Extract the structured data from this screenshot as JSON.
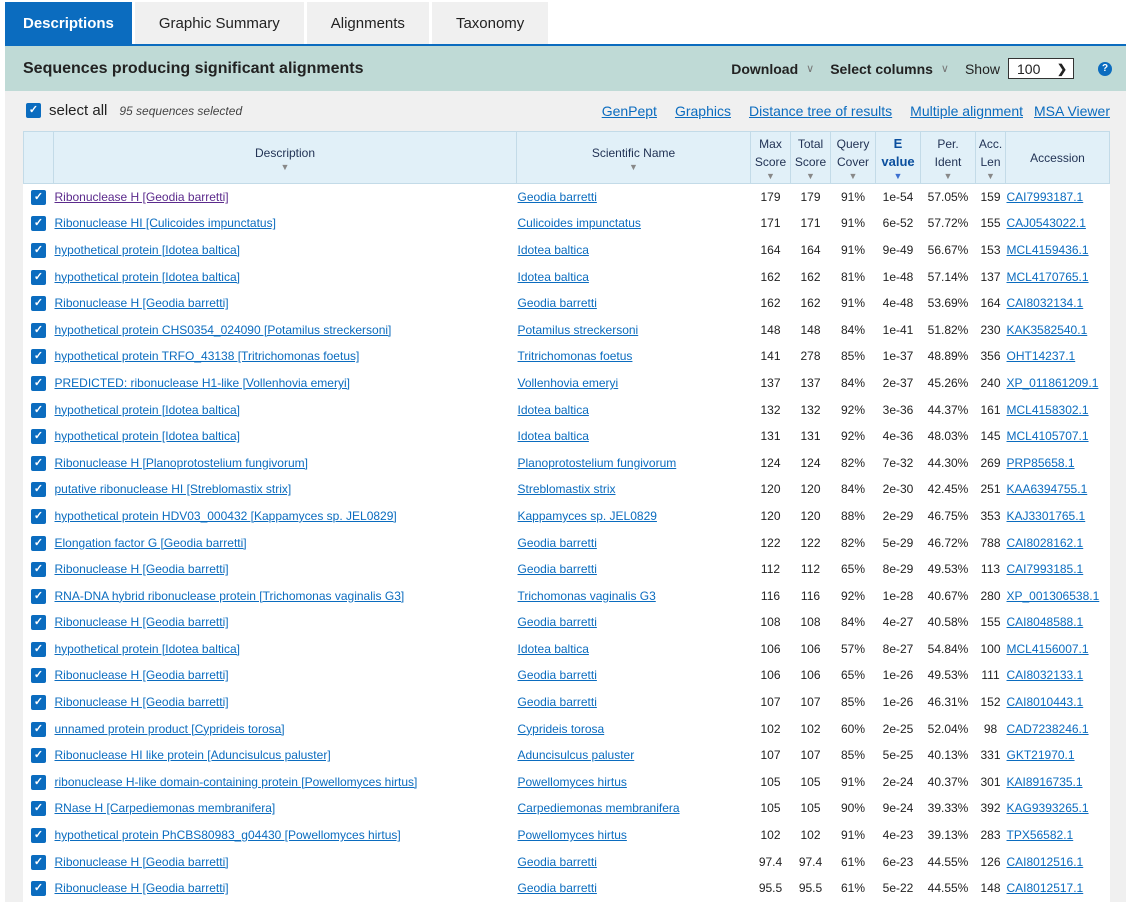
{
  "tabs": [
    "Descriptions",
    "Graphic Summary",
    "Alignments",
    "Taxonomy"
  ],
  "active_tab": 0,
  "header": {
    "title": "Sequences producing significant alignments",
    "download": "Download",
    "select_columns": "Select columns",
    "show_label": "Show",
    "show_value": "100"
  },
  "toolbar": {
    "select_all": "select all",
    "selected_count": "95 sequences selected",
    "links": [
      "GenPept",
      "Graphics",
      "Distance tree of results",
      "Multiple alignment",
      "MSA Viewer"
    ]
  },
  "columns": {
    "description": "Description",
    "scientific_name": "Scientific Name",
    "max_score": [
      "Max",
      "Score"
    ],
    "total_score": [
      "Total",
      "Score"
    ],
    "query_cover": [
      "Query",
      "Cover"
    ],
    "e_value": [
      "E",
      "value"
    ],
    "per_ident": [
      "Per.",
      "Ident"
    ],
    "acc_len": [
      "Acc.",
      "Len"
    ],
    "accession": "Accession"
  },
  "sorted_column": "e_value",
  "colors": {
    "accent": "#0b6cbf",
    "header_bar": "#bfdad6",
    "visited_link": "#5b2a8c"
  },
  "rows": [
    {
      "desc": "Ribonuclease H [Geodia barretti]",
      "sci": "Geodia barretti",
      "max": "179",
      "total": "179",
      "cover": "91%",
      "e": "1e-54",
      "ident": "57.05%",
      "len": "159",
      "acc": "CAI7993187.1",
      "visited": true
    },
    {
      "desc": "Ribonuclease HI [Culicoides impunctatus]",
      "sci": "Culicoides impunctatus",
      "max": "171",
      "total": "171",
      "cover": "91%",
      "e": "6e-52",
      "ident": "57.72%",
      "len": "155",
      "acc": "CAJ0543022.1"
    },
    {
      "desc": "hypothetical protein [Idotea baltica]",
      "sci": "Idotea baltica",
      "max": "164",
      "total": "164",
      "cover": "91%",
      "e": "9e-49",
      "ident": "56.67%",
      "len": "153",
      "acc": "MCL4159436.1"
    },
    {
      "desc": "hypothetical protein [Idotea baltica]",
      "sci": "Idotea baltica",
      "max": "162",
      "total": "162",
      "cover": "81%",
      "e": "1e-48",
      "ident": "57.14%",
      "len": "137",
      "acc": "MCL4170765.1"
    },
    {
      "desc": "Ribonuclease H [Geodia barretti]",
      "sci": "Geodia barretti",
      "max": "162",
      "total": "162",
      "cover": "91%",
      "e": "4e-48",
      "ident": "53.69%",
      "len": "164",
      "acc": "CAI8032134.1"
    },
    {
      "desc": "hypothetical protein CHS0354_024090 [Potamilus streckersoni]",
      "sci": "Potamilus streckersoni",
      "max": "148",
      "total": "148",
      "cover": "84%",
      "e": "1e-41",
      "ident": "51.82%",
      "len": "230",
      "acc": "KAK3582540.1"
    },
    {
      "desc": "hypothetical protein TRFO_43138 [Tritrichomonas foetus]",
      "sci": "Tritrichomonas foetus",
      "max": "141",
      "total": "278",
      "cover": "85%",
      "e": "1e-37",
      "ident": "48.89%",
      "len": "356",
      "acc": "OHT14237.1"
    },
    {
      "desc": "PREDICTED: ribonuclease H1-like [Vollenhovia emeryi]",
      "sci": "Vollenhovia emeryi",
      "max": "137",
      "total": "137",
      "cover": "84%",
      "e": "2e-37",
      "ident": "45.26%",
      "len": "240",
      "acc": "XP_011861209.1"
    },
    {
      "desc": "hypothetical protein [Idotea baltica]",
      "sci": "Idotea baltica",
      "max": "132",
      "total": "132",
      "cover": "92%",
      "e": "3e-36",
      "ident": "44.37%",
      "len": "161",
      "acc": "MCL4158302.1"
    },
    {
      "desc": "hypothetical protein [Idotea baltica]",
      "sci": "Idotea baltica",
      "max": "131",
      "total": "131",
      "cover": "92%",
      "e": "4e-36",
      "ident": "48.03%",
      "len": "145",
      "acc": "MCL4105707.1"
    },
    {
      "desc": "Ribonuclease H [Planoprotostelium fungivorum]",
      "sci": "Planoprotostelium fungivorum",
      "max": "124",
      "total": "124",
      "cover": "82%",
      "e": "7e-32",
      "ident": "44.30%",
      "len": "269",
      "acc": "PRP85658.1"
    },
    {
      "desc": "putative ribonuclease HI [Streblomastix strix]",
      "sci": "Streblomastix strix",
      "max": "120",
      "total": "120",
      "cover": "84%",
      "e": "2e-30",
      "ident": "42.45%",
      "len": "251",
      "acc": "KAA6394755.1"
    },
    {
      "desc": "hypothetical protein HDV03_000432 [Kappamyces sp. JEL0829]",
      "sci": "Kappamyces sp. JEL0829",
      "max": "120",
      "total": "120",
      "cover": "88%",
      "e": "2e-29",
      "ident": "46.75%",
      "len": "353",
      "acc": "KAJ3301765.1"
    },
    {
      "desc": "Elongation factor G [Geodia barretti]",
      "sci": "Geodia barretti",
      "max": "122",
      "total": "122",
      "cover": "82%",
      "e": "5e-29",
      "ident": "46.72%",
      "len": "788",
      "acc": "CAI8028162.1"
    },
    {
      "desc": "Ribonuclease H [Geodia barretti]",
      "sci": "Geodia barretti",
      "max": "112",
      "total": "112",
      "cover": "65%",
      "e": "8e-29",
      "ident": "49.53%",
      "len": "113",
      "acc": "CAI7993185.1"
    },
    {
      "desc": "RNA-DNA hybrid ribonuclease protein [Trichomonas vaginalis G3]",
      "sci": "Trichomonas vaginalis G3",
      "max": "116",
      "total": "116",
      "cover": "92%",
      "e": "1e-28",
      "ident": "40.67%",
      "len": "280",
      "acc": "XP_001306538.1"
    },
    {
      "desc": "Ribonuclease H [Geodia barretti]",
      "sci": "Geodia barretti",
      "max": "108",
      "total": "108",
      "cover": "84%",
      "e": "4e-27",
      "ident": "40.58%",
      "len": "155",
      "acc": "CAI8048588.1"
    },
    {
      "desc": "hypothetical protein [Idotea baltica]",
      "sci": "Idotea baltica",
      "max": "106",
      "total": "106",
      "cover": "57%",
      "e": "8e-27",
      "ident": "54.84%",
      "len": "100",
      "acc": "MCL4156007.1"
    },
    {
      "desc": "Ribonuclease H [Geodia barretti]",
      "sci": "Geodia barretti",
      "max": "106",
      "total": "106",
      "cover": "65%",
      "e": "1e-26",
      "ident": "49.53%",
      "len": "111",
      "acc": "CAI8032133.1"
    },
    {
      "desc": "Ribonuclease H [Geodia barretti]",
      "sci": "Geodia barretti",
      "max": "107",
      "total": "107",
      "cover": "85%",
      "e": "1e-26",
      "ident": "46.31%",
      "len": "152",
      "acc": "CAI8010443.1"
    },
    {
      "desc": "unnamed protein product [Cyprideis torosa]",
      "sci": "Cyprideis torosa",
      "max": "102",
      "total": "102",
      "cover": "60%",
      "e": "2e-25",
      "ident": "52.04%",
      "len": "98",
      "acc": "CAD7238246.1"
    },
    {
      "desc": "Ribonuclease HI like protein [Aduncisulcus paluster]",
      "sci": "Aduncisulcus paluster",
      "max": "107",
      "total": "107",
      "cover": "85%",
      "e": "5e-25",
      "ident": "40.13%",
      "len": "331",
      "acc": "GKT21970.1"
    },
    {
      "desc": "ribonuclease H-like domain-containing protein [Powellomyces hirtus]",
      "sci": "Powellomyces hirtus",
      "max": "105",
      "total": "105",
      "cover": "91%",
      "e": "2e-24",
      "ident": "40.37%",
      "len": "301",
      "acc": "KAI8916735.1"
    },
    {
      "desc": "RNase H [Carpediemonas membranifera]",
      "sci": "Carpediemonas membranifera",
      "max": "105",
      "total": "105",
      "cover": "90%",
      "e": "9e-24",
      "ident": "39.33%",
      "len": "392",
      "acc": "KAG9393265.1"
    },
    {
      "desc": "hypothetical protein PhCBS80983_g04430 [Powellomyces hirtus]",
      "sci": "Powellomyces hirtus",
      "max": "102",
      "total": "102",
      "cover": "91%",
      "e": "4e-23",
      "ident": "39.13%",
      "len": "283",
      "acc": "TPX56582.1"
    },
    {
      "desc": "Ribonuclease H [Geodia barretti]",
      "sci": "Geodia barretti",
      "max": "97.4",
      "total": "97.4",
      "cover": "61%",
      "e": "6e-23",
      "ident": "44.55%",
      "len": "126",
      "acc": "CAI8012516.1"
    },
    {
      "desc": "Ribonuclease H [Geodia barretti]",
      "sci": "Geodia barretti",
      "max": "95.5",
      "total": "95.5",
      "cover": "61%",
      "e": "5e-22",
      "ident": "44.55%",
      "len": "148",
      "acc": "CAI8012517.1"
    }
  ]
}
